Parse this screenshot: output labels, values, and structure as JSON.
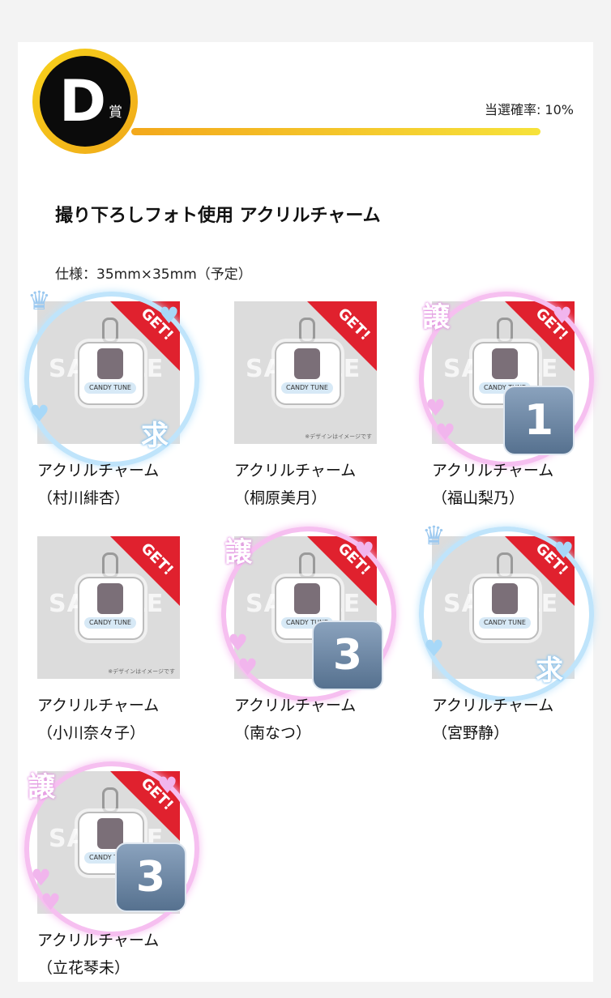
{
  "prize": {
    "letter": "D",
    "suffix": "賞",
    "win_rate": "当選確率: 10%"
  },
  "item": {
    "title": "撮り下ろしフォト使用 アクリルチャーム",
    "spec": "仕様：35mm×35mm（予定）"
  },
  "labels": {
    "get": "GET!",
    "sample": "SAMPLE",
    "image_note": "※デザインはイメージです",
    "charm_logo": "CANDY TUNE"
  },
  "items": [
    {
      "name": "アクリルチャーム",
      "member": "（村川緋杏）",
      "overlay": "wanted",
      "glyph": "求"
    },
    {
      "name": "アクリルチャーム",
      "member": "（桐原美月）",
      "overlay": "none",
      "glyph": ""
    },
    {
      "name": "アクリルチャーム",
      "member": "（福山梨乃）",
      "overlay": "offer",
      "glyph": "譲",
      "count": "1"
    },
    {
      "name": "アクリルチャーム",
      "member": "（小川奈々子）",
      "overlay": "none",
      "glyph": ""
    },
    {
      "name": "アクリルチャーム",
      "member": "（南なつ）",
      "overlay": "offer",
      "glyph": "譲",
      "count": "3"
    },
    {
      "name": "アクリルチャーム",
      "member": "（宮野静）",
      "overlay": "wanted",
      "glyph": "求"
    },
    {
      "name": "アクリルチャーム",
      "member": "（立花琴未）",
      "overlay": "offer",
      "glyph": "譲",
      "count": "3"
    }
  ],
  "colors": {
    "accent_gold": "#f3a81b",
    "get_red": "#e0212e",
    "wanted_blue": "#bfe4fb",
    "offer_pink": "#f6bff0"
  }
}
